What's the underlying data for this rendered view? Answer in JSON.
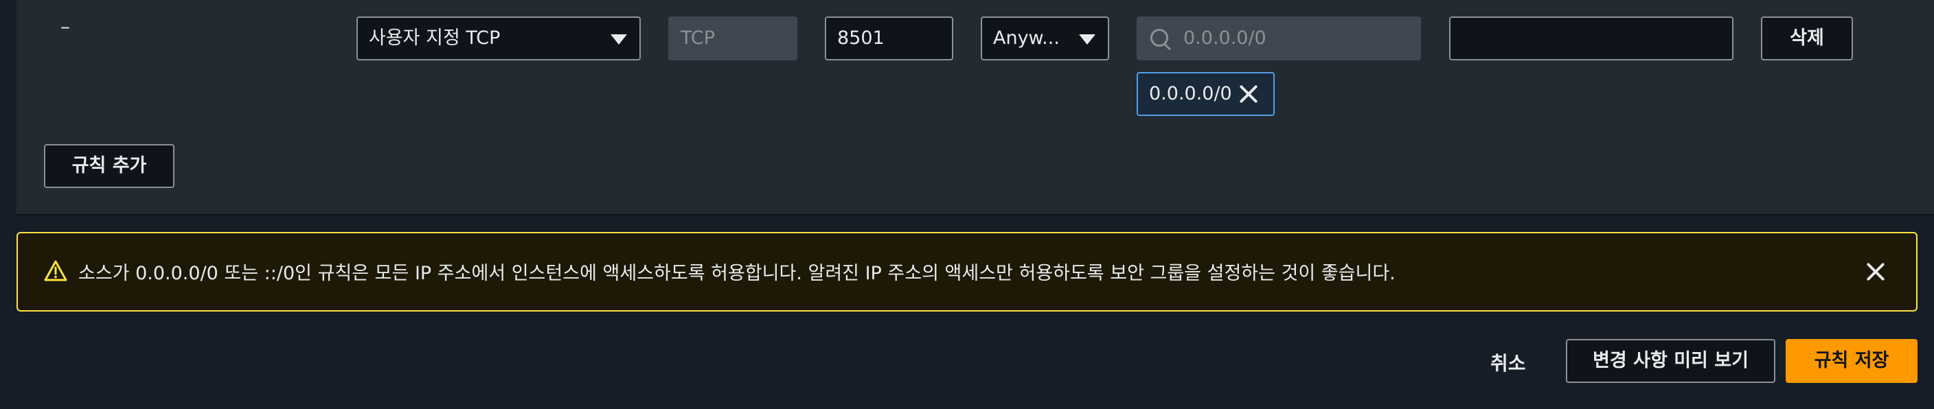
{
  "rule": {
    "dash": "–",
    "type_select": "사용자 지정 TCP",
    "protocol": "TCP",
    "port_range": "8501",
    "source_type": "Anyw...",
    "source_search_placeholder": "0.0.0.0/0",
    "source_token": "0.0.0.0/0",
    "description_value": "",
    "delete_label": "삭제"
  },
  "add_rule_label": "규칙 추가",
  "alert": {
    "type": "warning",
    "message": "소스가 0.0.0.0/0 또는 ::/0인 규칙은 모든 IP 주소에서 인스턴스에 액세스하도록 허용합니다. 알려진 IP 주소의 액세스만 허용하도록 보안 그룹을 설정하는 것이 좋습니다."
  },
  "footer": {
    "cancel_label": "취소",
    "preview_label": "변경 사항 미리 보기",
    "save_label": "규칙 저장"
  },
  "colors": {
    "accent": "#ff9900",
    "warning_border": "#ffe347",
    "token_border": "#539fe5"
  }
}
